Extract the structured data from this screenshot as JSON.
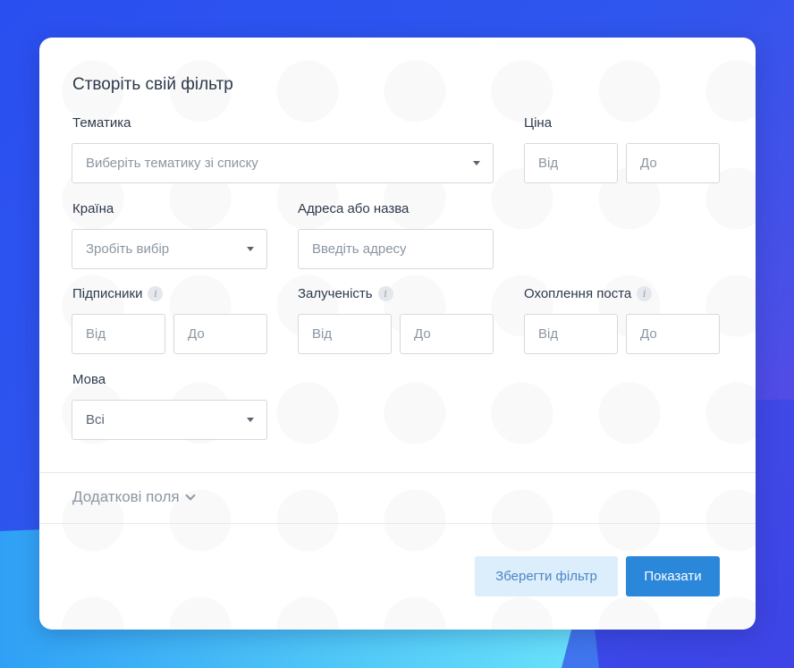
{
  "form": {
    "title": "Створіть свій фільтр",
    "topic": {
      "label": "Тематика",
      "placeholder": "Виберіть тематику зі списку"
    },
    "price": {
      "label": "Ціна",
      "from": "Від",
      "to": "До"
    },
    "country": {
      "label": "Країна",
      "placeholder": "Зробіть вибір"
    },
    "address": {
      "label": "Адреса або назва",
      "placeholder": "Введіть адресу"
    },
    "subscribers": {
      "label": "Підписники",
      "from": "Від",
      "to": "До"
    },
    "engagement": {
      "label": "Залученість",
      "from": "Від",
      "to": "До"
    },
    "reach": {
      "label": "Охоплення поста",
      "from": "Від",
      "to": "До"
    },
    "language": {
      "label": "Мова",
      "value": "Всі"
    },
    "extra_fields_label": "Додаткові поля",
    "info_icon_glyph": "i"
  },
  "buttons": {
    "save_label": "Зберегти фільтр",
    "show_label": "Показати"
  },
  "colors": {
    "primary": "#2b87da",
    "secondary_bg": "#dceefb",
    "secondary_text": "#4a86c7"
  }
}
